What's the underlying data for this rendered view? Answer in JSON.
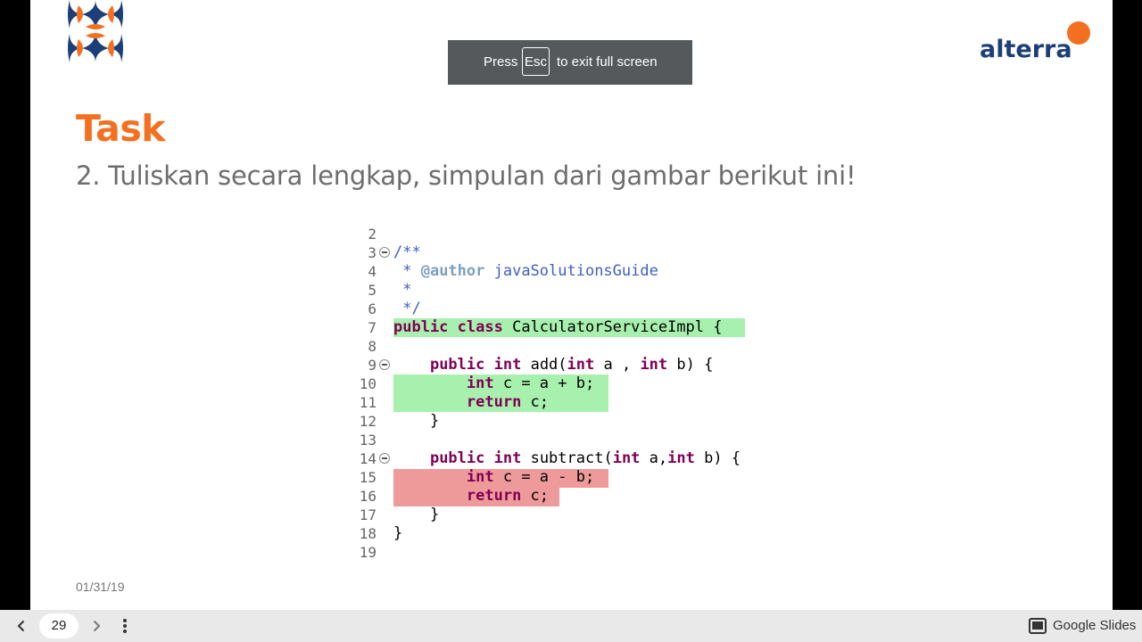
{
  "slide": {
    "title": "Task",
    "subtitle": "2. Tuliskan secara lengkap, simpulan dari gambar berikut ini!",
    "date": "01/31/19",
    "brand_logo_text": "alterra",
    "colors": {
      "accent": "#f37021",
      "brand_blue": "#1c3f79",
      "highlight_green": "#a8f0ae",
      "highlight_red": "#ef9a9a"
    }
  },
  "code": {
    "line_numbers": [
      "2",
      "3",
      "4",
      "5",
      "6",
      "7",
      "8",
      "9",
      "10",
      "11",
      "12",
      "13",
      "14",
      "15",
      "16",
      "17",
      "18",
      "19"
    ],
    "l3": "/**",
    "l4_star": " * ",
    "l4_tag": "@author",
    "l4_text": " javaSolutionsGuide",
    "l5": " *",
    "l6": " */",
    "l7_kw1": "public",
    "l7_kw2": "class",
    "l7_text": " CalculatorServiceImpl {",
    "l9_kw1": "public",
    "l9_kw2": "int",
    "l9_t1": " add(",
    "l9_kw3": "int",
    "l9_t2": " a , ",
    "l9_kw4": "int",
    "l9_t3": " b) {",
    "l10_kw": "int",
    "l10_text": " c = a + b;",
    "l11_kw": "return",
    "l11_text": " c;",
    "l12": "}",
    "l14_kw1": "public",
    "l14_kw2": "int",
    "l14_t1": " subtract(",
    "l14_kw3": "int",
    "l14_t2": " a,",
    "l14_kw4": "int",
    "l14_t3": " b) {",
    "l15_kw": "int",
    "l15_text": " c = a - b;",
    "l16_kw": "return",
    "l16_text": " c;",
    "l17": "}",
    "l18": "}"
  },
  "fullscreen_toast": {
    "before": "Press",
    "key": "Esc",
    "after": "to exit full screen"
  },
  "bottom_bar": {
    "page_number": "29",
    "app_name": "Google Slides",
    "icons": [
      "chevron-left-icon",
      "chevron-right-icon",
      "more-vert-icon",
      "slides-icon"
    ]
  }
}
